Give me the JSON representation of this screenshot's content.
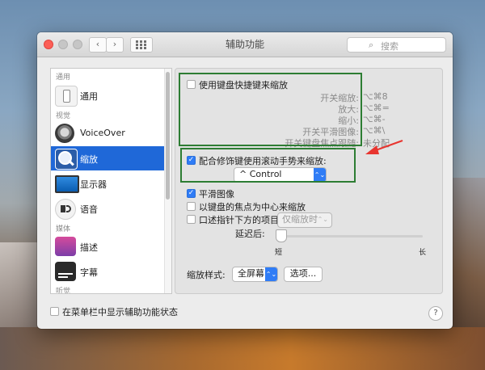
{
  "window": {
    "title": "辅助功能",
    "search_placeholder": "搜索"
  },
  "sidebar": {
    "sections": {
      "general": "通用",
      "vision": "视觉",
      "media": "媒体",
      "hearing": "听觉"
    },
    "items": [
      {
        "label": "通用",
        "icon": "general-icon"
      },
      {
        "label": "VoiceOver",
        "icon": "voiceover-icon"
      },
      {
        "label": "缩放",
        "icon": "zoom-icon",
        "selected": true
      },
      {
        "label": "显示器",
        "icon": "display-icon"
      },
      {
        "label": "语音",
        "icon": "speech-icon"
      },
      {
        "label": "描述",
        "icon": "descriptions-icon"
      },
      {
        "label": "字幕",
        "icon": "captions-icon"
      }
    ]
  },
  "zoom": {
    "keyboard_shortcuts_checkbox": {
      "label": "使用键盘快捷键来缩放",
      "checked": false
    },
    "shortcuts": [
      {
        "name": "开关缩放:",
        "keys": "⌥⌘8"
      },
      {
        "name": "放大:",
        "keys": "⌥⌘="
      },
      {
        "name": "缩小:",
        "keys": "⌥⌘-"
      },
      {
        "name": "开关平滑图像:",
        "keys": "⌥⌘\\"
      },
      {
        "name": "开关键盘焦点跟随:",
        "keys": "未分配"
      }
    ],
    "scroll_gesture_checkbox": {
      "label": "配合修饰键使用滚动手势来缩放:",
      "checked": true
    },
    "modifier_popup": "^ Control",
    "smooth_images": {
      "label": "平滑图像",
      "checked": true
    },
    "follow_focus": {
      "label": "以键盘的焦点为中心来缩放",
      "checked": false
    },
    "speak_items": {
      "label": "口述指针下方的项目",
      "checked": false
    },
    "speak_items_popup": "仅缩放时",
    "delay_label": "延迟后:",
    "delay_short": "短",
    "delay_long": "长",
    "delay_value_fraction": 0.0,
    "zoom_style_label": "缩放样式:",
    "zoom_style_popup": "全屏幕",
    "options_button": "选项..."
  },
  "footer": {
    "show_status_checkbox": {
      "label": "在菜单栏中显示辅助功能状态",
      "checked": false
    },
    "help_button": "?"
  },
  "colors": {
    "selection": "#1f68d8",
    "accent": "#2f7cf6",
    "annotation_box": "#2d7d33",
    "annotation_arrow": "#e8352f"
  }
}
